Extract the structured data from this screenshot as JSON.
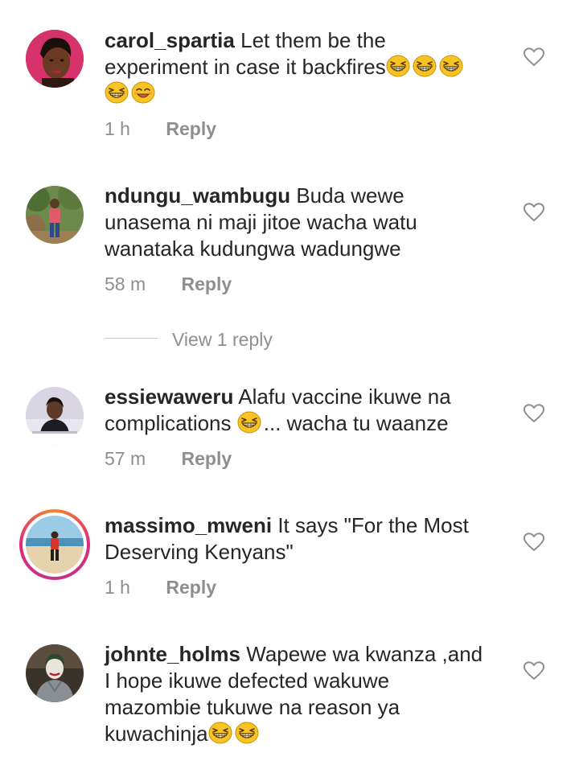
{
  "comments": [
    {
      "username": "carol_spartia",
      "text_line1": "Let them be the",
      "text_line2": "experiment in case it backfires",
      "time": "1 h",
      "reply_label": "Reply",
      "avatar": "woman-selfie-pink-background"
    },
    {
      "username": "ndungu_wambugu",
      "text_line1": "Buda wewe",
      "text_line2": "unasema ni maji jitoe wacha watu",
      "text_line3": "wanataka kudungwa wadungwe",
      "time": "58 m",
      "reply_label": "Reply",
      "view_replies_label": "View 1 reply",
      "avatar": "man-outdoors-trees"
    },
    {
      "username": "essiewaweru",
      "text_line1": "Alafu vaccine ikuwe na",
      "text_line2a": "complications",
      "text_line2b": "... wacha tu waanze",
      "time": "57 m",
      "reply_label": "Reply",
      "avatar": "woman-at-desk"
    },
    {
      "username": "massimo_mweni",
      "text_line1": "It says \"For the Most",
      "text_line2": "Deserving Kenyans\"",
      "time": "1 h",
      "reply_label": "Reply",
      "avatar": "man-on-beach-story-ring"
    },
    {
      "username": "johnte_holms",
      "text_line1": "Wapewe wa kwanza ,and",
      "text_line2": "I hope ikuwe defected wakuwe",
      "text_line3": "mazombie tukuwe na reason ya",
      "text_line4": "kuwachinja",
      "avatar": "joker-hoodie"
    }
  ],
  "icons": {
    "like": "heart-outline-icon",
    "laugh": "grinning-squinting-face-emoji",
    "smile": "smiling-face-emoji"
  },
  "colors": {
    "text": "#262626",
    "secondary": "#8e8e8e",
    "story_ring_start": "#f58529",
    "story_ring_end": "#dd2a7b"
  }
}
